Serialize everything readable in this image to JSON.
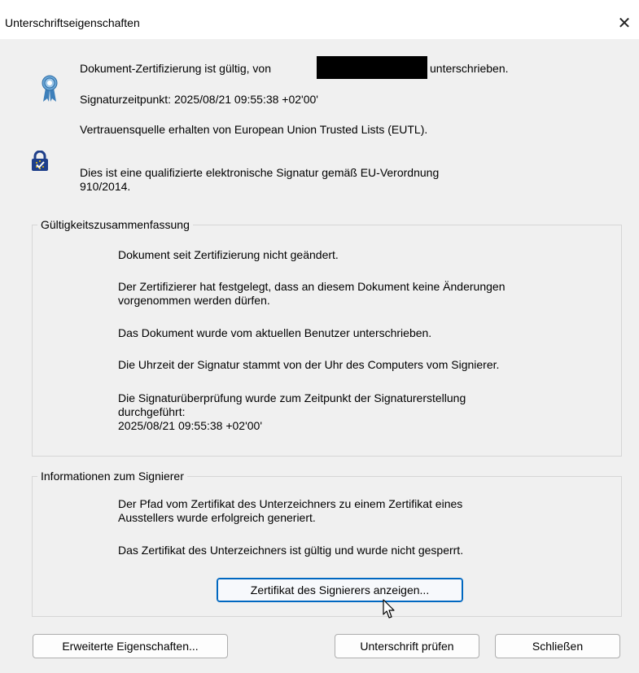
{
  "window": {
    "title": "Unterschriftseigenschaften",
    "close_glyph": "✕"
  },
  "header": {
    "certification_prefix": "Dokument-Zertifizierung ist gültig, von",
    "certification_suffix": "unterschrieben.",
    "signing_time": "Signaturzeitpunkt:  2025/08/21 09:55:38 +02'00'",
    "trust_source": "Vertrauensquelle erhalten von European Union Trusted Lists (EUTL).",
    "qualified_signature": "Dies ist eine qualifizierte elektronische Signatur gemäß EU-Verordnung",
    "qualified_signature_line2": "910/2014."
  },
  "validity_summary": {
    "legend": "Gültigkeitszusammenfassung",
    "items": [
      "Dokument seit Zertifizierung nicht geändert.",
      "Der Zertifizierer hat festgelegt, dass an diesem Dokument keine Änderungen",
      "vorgenommen werden dürfen.",
      "Das Dokument wurde vom aktuellen Benutzer unterschrieben.",
      "Die Uhrzeit der Signatur stammt von der Uhr des Computers vom Signierer.",
      "Die Signaturüberprüfung wurde zum Zeitpunkt der Signaturerstellung",
      "durchgeführt:",
      "2025/08/21 09:55:38 +02'00'"
    ]
  },
  "signer_info": {
    "legend": "Informationen zum Signierer",
    "items": [
      "Der Pfad vom Zertifikat des Unterzeichners zu einem Zertifikat eines",
      "Ausstellers wurde erfolgreich generiert.",
      "Das Zertifikat des Unterzeichners ist gültig und wurde nicht gesperrt."
    ],
    "show_cert_button": "Zertifikat des Signierers anzeigen..."
  },
  "footer": {
    "advanced_button": "Erweiterte Eigenschaften...",
    "verify_button": "Unterschrift prüfen",
    "close_button": "Schließen"
  },
  "colors": {
    "dialog_bg": "#f0f0f0",
    "accent": "#0067c0",
    "ribbon_blue": "#4a90c8",
    "lock_blue": "#1e3f8a",
    "lock_gold": "#f2c500"
  },
  "icons": {
    "certificate": "ribbon-icon",
    "eu_lock": "eu-trust-lock-icon",
    "cursor": "mouse-pointer-icon"
  }
}
